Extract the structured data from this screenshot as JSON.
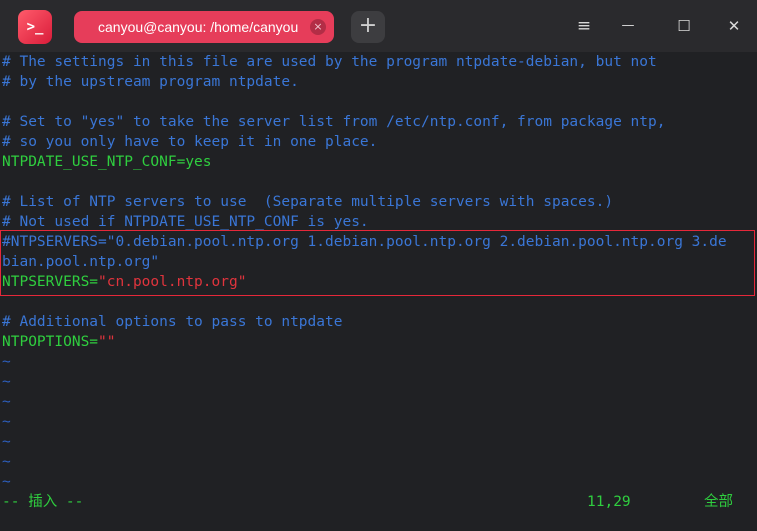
{
  "titlebar": {
    "app_icon_glyph": ">_",
    "tab_title": "canyou@canyou: /home/canyou",
    "tab_close_glyph": "×",
    "new_tab_glyph": "+",
    "menu_glyph": "≡",
    "minimize_glyph": "—",
    "maximize_glyph": "☐",
    "close_glyph": "✕"
  },
  "editor": {
    "lines": [
      {
        "text": "# The settings in this file are used by the program ntpdate-debian, but not"
      },
      {
        "text": "# by the upstream program ntpdate."
      },
      {
        "text": ""
      },
      {
        "text": "# Set to \"yes\" to take the server list from /etc/ntp.conf, from package ntp,"
      },
      {
        "text": "# so you only have to keep it in one place."
      },
      {
        "key": "NTPDATE_USE_NTP_CONF=yes"
      },
      {
        "text": ""
      },
      {
        "text": "# List of NTP servers to use  (Separate multiple servers with spaces.)"
      },
      {
        "text": "# Not used if NTPDATE_USE_NTP_CONF is yes."
      },
      {
        "text": "#NTPSERVERS=\"0.debian.pool.ntp.org 1.debian.pool.ntp.org 2.debian.pool.ntp.org 3.de"
      },
      {
        "text": "bian.pool.ntp.org\""
      },
      {
        "key": "NTPSERVERS=",
        "value": "\"cn.pool.ntp.org\""
      },
      {
        "text": ""
      },
      {
        "text": "# Additional options to pass to ntpdate"
      },
      {
        "key": "NTPOPTIONS=",
        "value": "\"\""
      },
      {
        "text": "~"
      },
      {
        "text": "~"
      },
      {
        "text": "~"
      },
      {
        "text": "~"
      },
      {
        "text": "~"
      },
      {
        "text": "~"
      },
      {
        "text": "~"
      }
    ]
  },
  "statusbar": {
    "mode": "-- 插入 --",
    "cursor": "11,29",
    "position": "全部"
  },
  "colors": {
    "comment": "#3a76d6",
    "keyword": "#2fce3f",
    "string": "#e0343d",
    "tab_accent": "#e63d5a",
    "highlight_border": "#e6283a"
  }
}
